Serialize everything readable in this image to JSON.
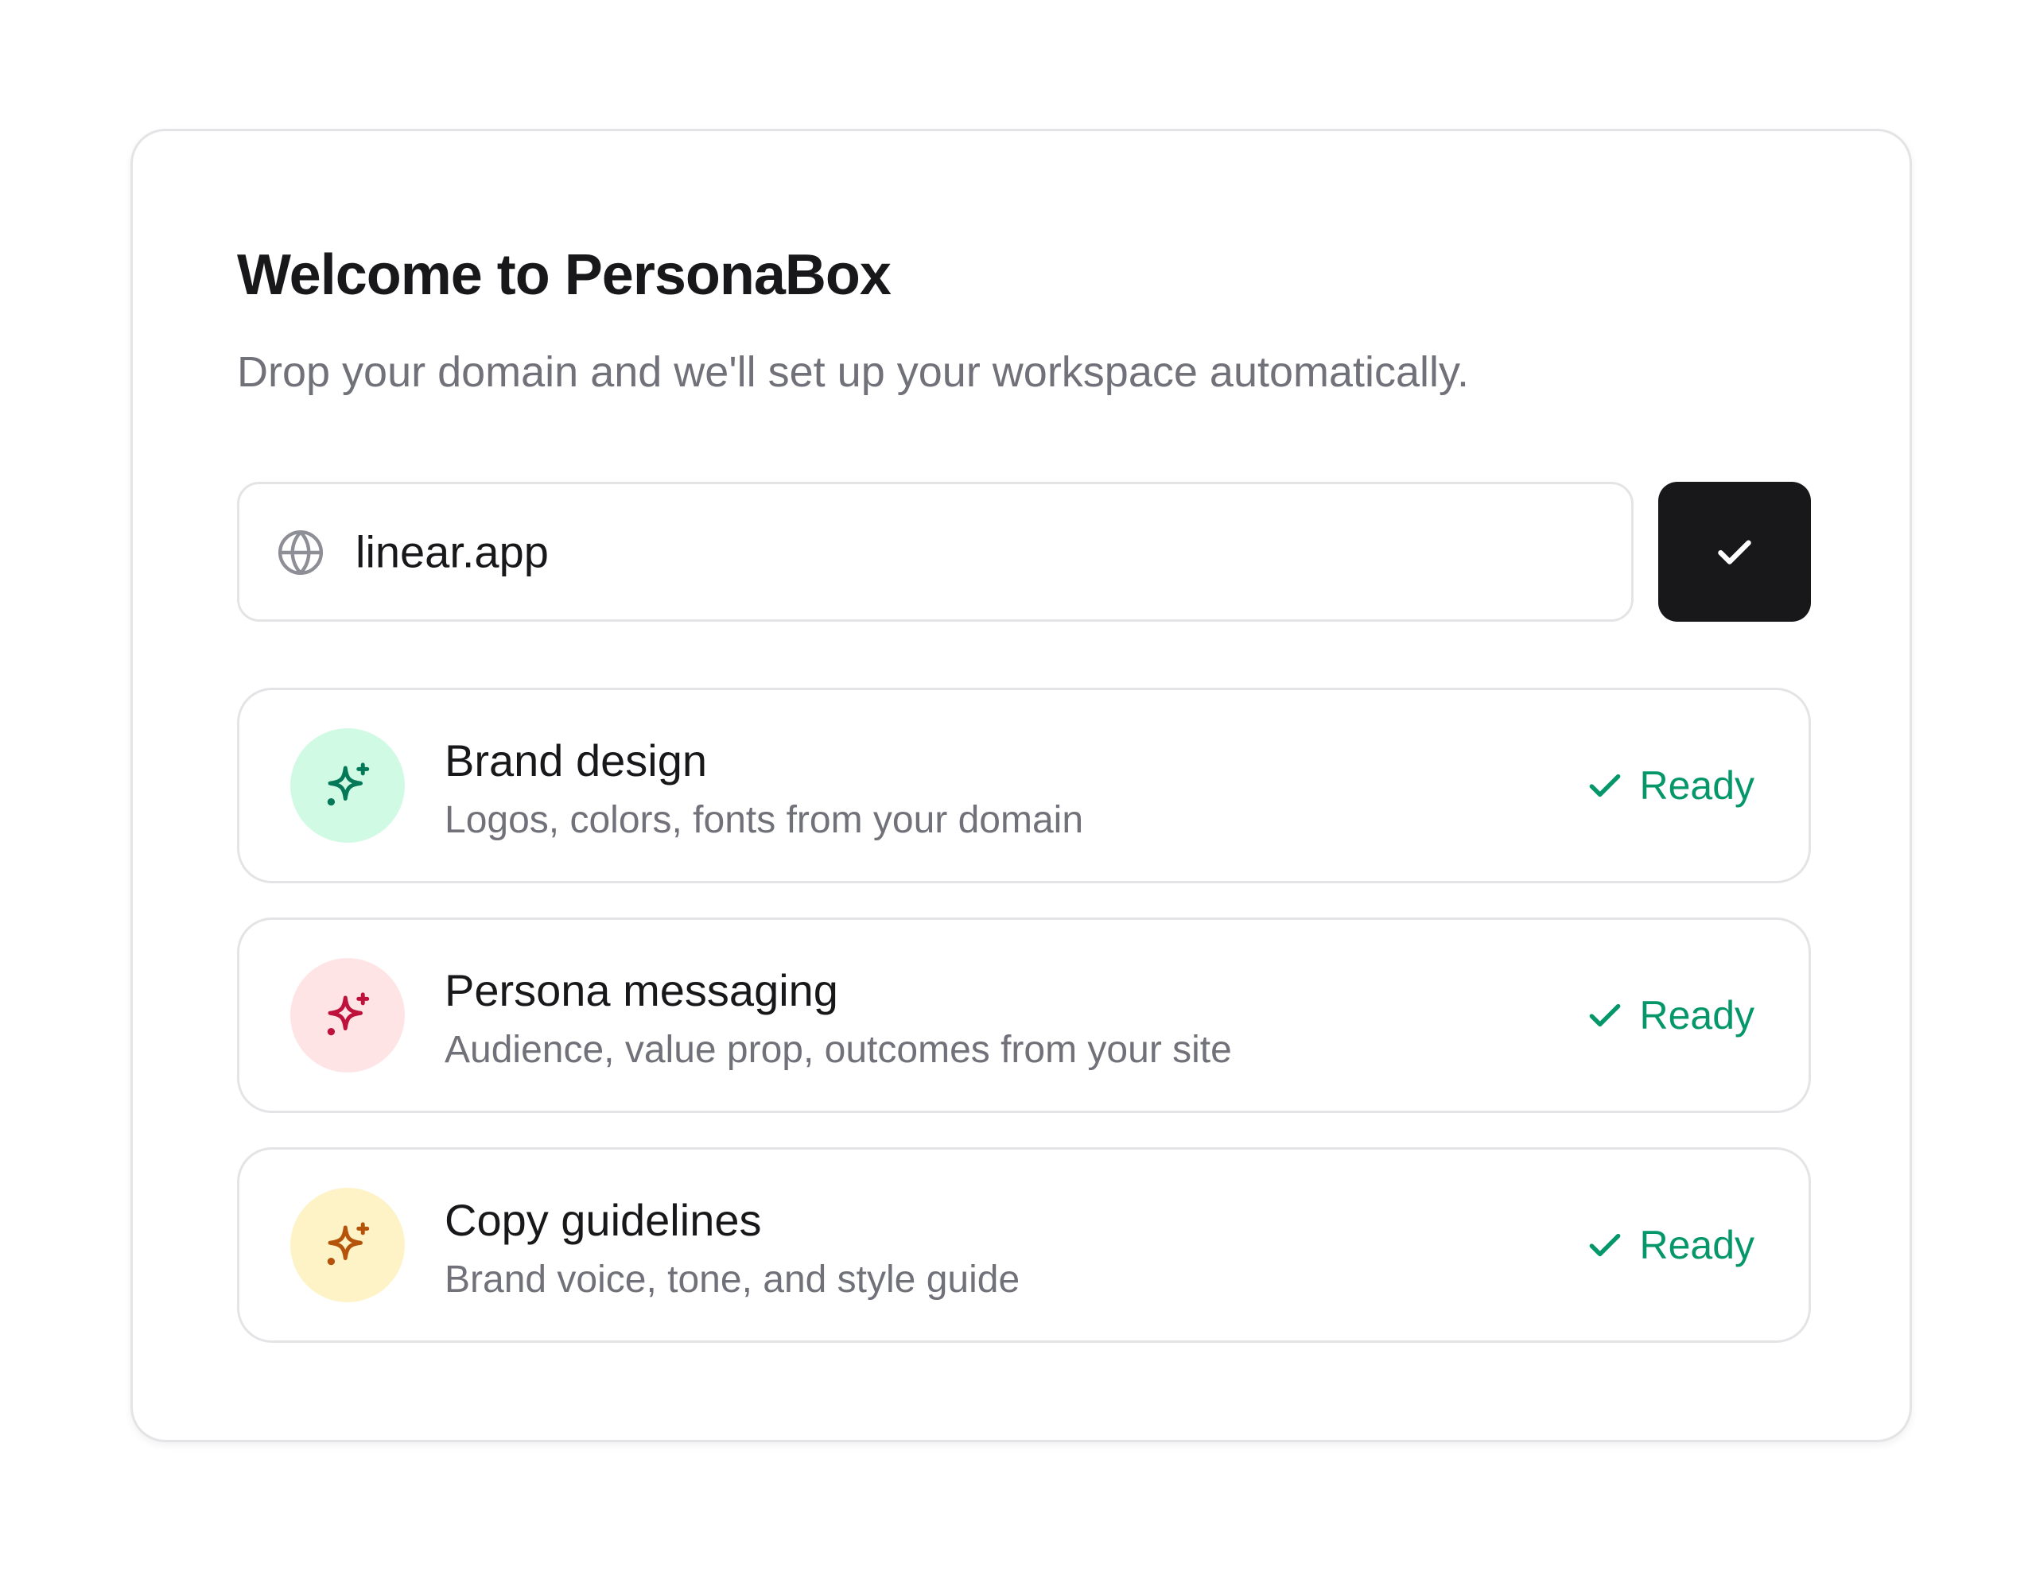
{
  "colors": {
    "accent_dark": "#18181b",
    "ready_green": "#059669",
    "muted_text": "#71717a",
    "border": "#e4e4e7"
  },
  "header": {
    "title": "Welcome to PersonaBox",
    "subtitle": "Drop your domain and we'll set up your workspace automatically."
  },
  "domain_input": {
    "icon": "globe-icon",
    "value": "linear.app"
  },
  "submit_button": {
    "icon": "check-icon"
  },
  "items": [
    {
      "title": "Brand design",
      "description": "Logos, colors, fonts from your domain",
      "icon": "sparkles-icon",
      "icon_color": "#047857",
      "icon_bg": "#d1fae5",
      "status": "Ready",
      "status_icon": "check-icon"
    },
    {
      "title": "Persona messaging",
      "description": "Audience, value prop, outcomes from your site",
      "icon": "sparkles-icon",
      "icon_color": "#be123c",
      "icon_bg": "#ffe4e6",
      "status": "Ready",
      "status_icon": "check-icon"
    },
    {
      "title": "Copy guidelines",
      "description": "Brand voice, tone, and style guide",
      "icon": "sparkles-icon",
      "icon_color": "#b45309",
      "icon_bg": "#fef3c7",
      "status": "Ready",
      "status_icon": "check-icon"
    }
  ]
}
